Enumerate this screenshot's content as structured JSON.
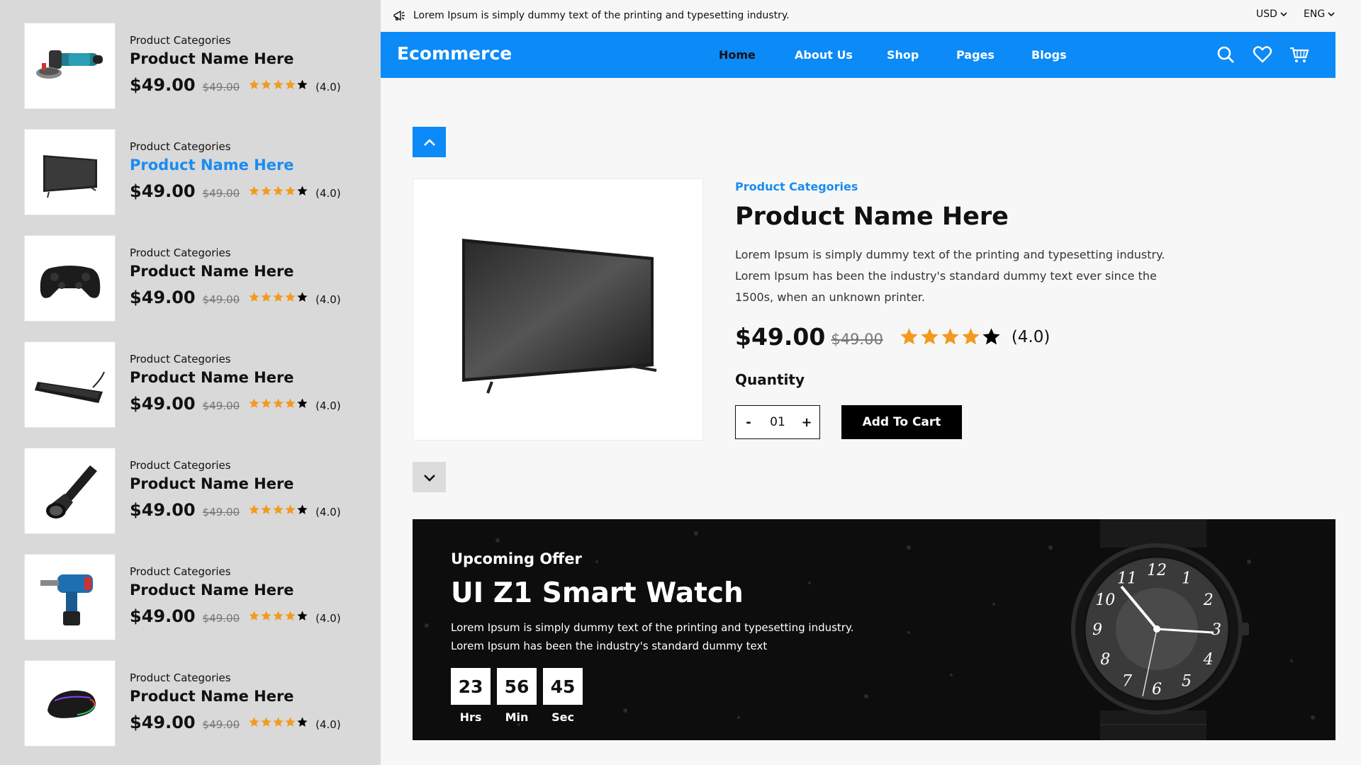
{
  "topbar": {
    "message": "Lorem Ipsum is simply dummy text of the printing and typesetting industry.",
    "currency": "USD",
    "language": "ENG"
  },
  "navbar": {
    "brand": "Ecommerce",
    "links": [
      "Home",
      "About Us",
      "Shop",
      "Pages",
      "Blogs"
    ],
    "active_link": "Home"
  },
  "sidebar": {
    "items": [
      {
        "category": "Product Categories",
        "name": "Product Name Here",
        "price": "$49.00",
        "old_price": "$49.00",
        "rating": "(4.0)",
        "stars": 4,
        "image": "angle-grinder-icon",
        "active": false
      },
      {
        "category": "Product Categories",
        "name": "Product Name Here",
        "price": "$49.00",
        "old_price": "$49.00",
        "rating": "(4.0)",
        "stars": 4,
        "image": "tv-icon",
        "active": true
      },
      {
        "category": "Product Categories",
        "name": "Product Name Here",
        "price": "$49.00",
        "old_price": "$49.00",
        "rating": "(4.0)",
        "stars": 4,
        "image": "gamepad-icon",
        "active": false
      },
      {
        "category": "Product Categories",
        "name": "Product Name Here",
        "price": "$49.00",
        "old_price": "$49.00",
        "rating": "(4.0)",
        "stars": 4,
        "image": "keyboard-icon",
        "active": false
      },
      {
        "category": "Product Categories",
        "name": "Product Name Here",
        "price": "$49.00",
        "old_price": "$49.00",
        "rating": "(4.0)",
        "stars": 4,
        "image": "flashlight-icon",
        "active": false
      },
      {
        "category": "Product Categories",
        "name": "Product Name Here",
        "price": "$49.00",
        "old_price": "$49.00",
        "rating": "(4.0)",
        "stars": 4,
        "image": "drill-icon",
        "active": false
      },
      {
        "category": "Product Categories",
        "name": "Product Name Here",
        "price": "$49.00",
        "old_price": "$49.00",
        "rating": "(4.0)",
        "stars": 4,
        "image": "mouse-icon",
        "active": false
      }
    ]
  },
  "product": {
    "category": "Product Categories",
    "name": "Product Name Here",
    "description": "Lorem Ipsum is simply dummy text of the printing and typesetting industry. Lorem Ipsum has been the industry's standard dummy text ever since the 1500s, when an unknown printer.",
    "price": "$49.00",
    "old_price": "$49.00",
    "stars": 4,
    "rating": "(4.0)",
    "quantity_label": "Quantity",
    "quantity": "01",
    "minus": "-",
    "plus": "+",
    "add_to_cart": "Add To Cart"
  },
  "banner": {
    "eyebrow": "Upcoming Offer",
    "title": "UI Z1 Smart Watch",
    "description": "Lorem Ipsum is simply dummy text of the printing and typesetting industry. Lorem Ipsum has been the industry's standard dummy text",
    "countdown": [
      {
        "value": "23",
        "label": "Hrs"
      },
      {
        "value": "56",
        "label": "Min"
      },
      {
        "value": "45",
        "label": "Sec"
      }
    ],
    "watch_numbers": [
      "12",
      "1",
      "2",
      "3",
      "4",
      "5",
      "6",
      "7",
      "8",
      "9",
      "10",
      "11"
    ]
  },
  "colors": {
    "accent": "#0b8af8",
    "star": "#f39a1e",
    "sidebar_bg": "#d9d9d9"
  }
}
